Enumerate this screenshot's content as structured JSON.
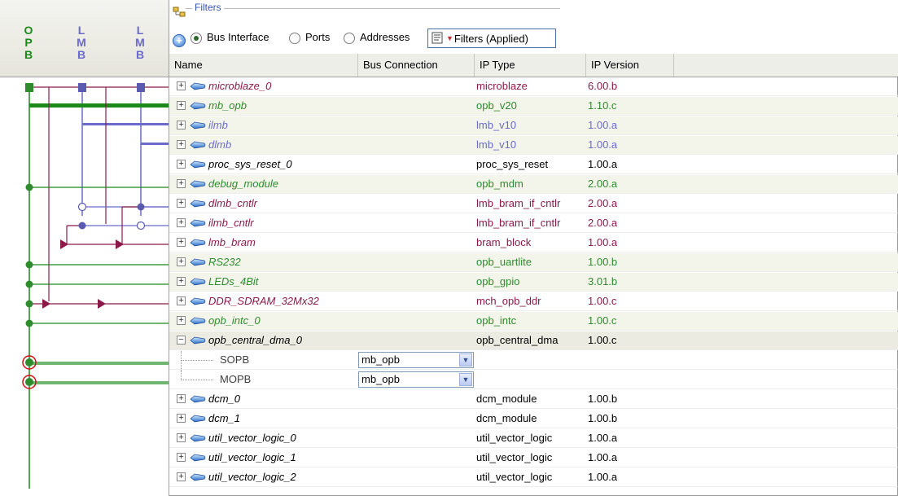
{
  "bus_panel": {
    "buses": [
      {
        "label": "O\nP\nB",
        "color": "#1a8a1a"
      },
      {
        "label": "L\nM\nB",
        "color": "#6a6acc"
      },
      {
        "label": "L\nM\nB",
        "color": "#6a6acc"
      }
    ]
  },
  "filters": {
    "legend": "Filters",
    "options": [
      {
        "label": "Bus Interface",
        "selected": true
      },
      {
        "label": "Ports",
        "selected": false
      },
      {
        "label": "Addresses",
        "selected": false
      }
    ],
    "applied_button": "Filters (Applied)"
  },
  "table": {
    "columns": [
      "Name",
      "Bus Connection",
      "IP Type",
      "IP Version"
    ],
    "rows": [
      {
        "name": "microblaze_0",
        "ip_type": "microblaze",
        "version": "6.00.b",
        "color": "#8b1a4a",
        "expanded": false
      },
      {
        "name": "mb_opb",
        "ip_type": "opb_v20",
        "version": "1.10.c",
        "color": "#2e8b2e",
        "expanded": false
      },
      {
        "name": "ilmb",
        "ip_type": "lmb_v10",
        "version": "1.00.a",
        "color": "#6a6acc",
        "expanded": false
      },
      {
        "name": "dlmb",
        "ip_type": "lmb_v10",
        "version": "1.00.a",
        "color": "#6a6acc",
        "expanded": false
      },
      {
        "name": "proc_sys_reset_0",
        "ip_type": "proc_sys_reset",
        "version": "1.00.a",
        "color": "#000000",
        "expanded": false
      },
      {
        "name": "debug_module",
        "ip_type": "opb_mdm",
        "version": "2.00.a",
        "color": "#2e8b2e",
        "expanded": false
      },
      {
        "name": "dlmb_cntlr",
        "ip_type": "lmb_bram_if_cntlr",
        "version": "2.00.a",
        "color": "#8b1a4a",
        "expanded": false
      },
      {
        "name": "ilmb_cntlr",
        "ip_type": "lmb_bram_if_cntlr",
        "version": "2.00.a",
        "color": "#8b1a4a",
        "expanded": false
      },
      {
        "name": "lmb_bram",
        "ip_type": "bram_block",
        "version": "1.00.a",
        "color": "#8b1a4a",
        "expanded": false
      },
      {
        "name": "RS232",
        "ip_type": "opb_uartlite",
        "version": "1.00.b",
        "color": "#2e8b2e",
        "expanded": false
      },
      {
        "name": "LEDs_4Bit",
        "ip_type": "opb_gpio",
        "version": "3.01.b",
        "color": "#2e8b2e",
        "expanded": false
      },
      {
        "name": "DDR_SDRAM_32Mx32",
        "ip_type": "mch_opb_ddr",
        "version": "1.00.c",
        "color": "#8b1a4a",
        "expanded": false
      },
      {
        "name": "opb_intc_0",
        "ip_type": "opb_intc",
        "version": "1.00.c",
        "color": "#2e8b2e",
        "expanded": false
      },
      {
        "name": "opb_central_dma_0",
        "ip_type": "opb_central_dma",
        "version": "1.00.c",
        "color": "#000000",
        "expanded": true
      },
      {
        "name": "dcm_0",
        "ip_type": "dcm_module",
        "version": "1.00.b",
        "color": "#000000",
        "expanded": false
      },
      {
        "name": "dcm_1",
        "ip_type": "dcm_module",
        "version": "1.00.b",
        "color": "#000000",
        "expanded": false
      },
      {
        "name": "util_vector_logic_0",
        "ip_type": "util_vector_logic",
        "version": "1.00.a",
        "color": "#000000",
        "expanded": false
      },
      {
        "name": "util_vector_logic_1",
        "ip_type": "util_vector_logic",
        "version": "1.00.a",
        "color": "#000000",
        "expanded": false
      },
      {
        "name": "util_vector_logic_2",
        "ip_type": "util_vector_logic",
        "version": "1.00.a",
        "color": "#000000",
        "expanded": false
      }
    ],
    "dma_ports": [
      {
        "label": "SOPB",
        "bus": "mb_opb"
      },
      {
        "label": "MOPB",
        "bus": "mb_opb"
      }
    ]
  }
}
